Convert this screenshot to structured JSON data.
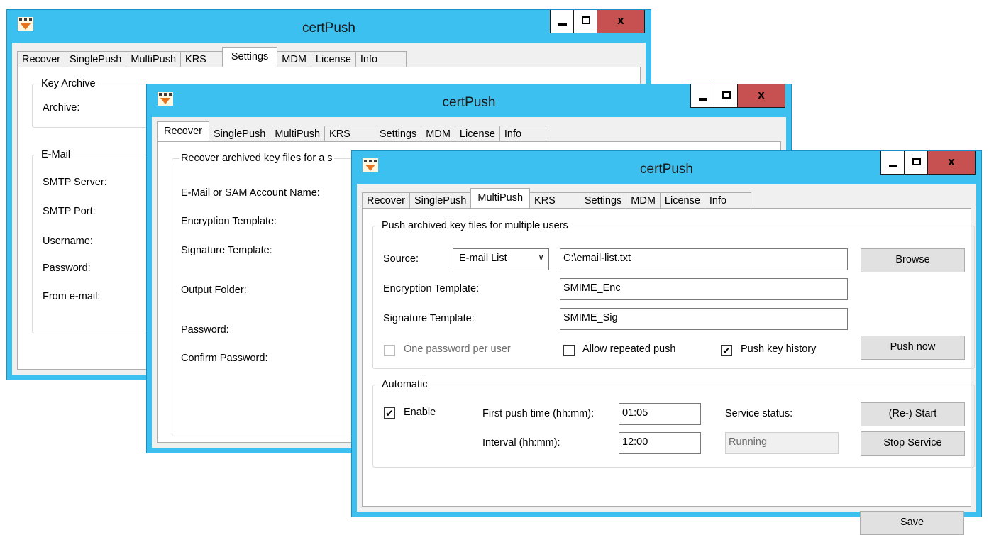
{
  "app_title": "certPush",
  "colors": {
    "titlebar": "#3cc0f0",
    "close_button": "#c75050"
  },
  "tabs": [
    "Recover",
    "SinglePush",
    "MultiPush",
    "KRS",
    "Settings",
    "MDM",
    "License",
    "Info"
  ],
  "window1": {
    "active_tab": "Settings",
    "key_archive": {
      "legend": "Key Archive",
      "archive_label": "Archive:"
    },
    "email": {
      "legend": "E-Mail",
      "smtp_server_label": "SMTP Server:",
      "smtp_port_label": "SMTP Port:",
      "username_label": "Username:",
      "password_label": "Password:",
      "from_label": "From e-mail:"
    }
  },
  "window2": {
    "active_tab": "Recover",
    "group_legend": "Recover archived key files for a s",
    "email_sam_label": "E-Mail or SAM Account Name:",
    "encryption_template_label": "Encryption Template:",
    "signature_template_label": "Signature Template:",
    "output_folder_label": "Output Folder:",
    "password_label": "Password:",
    "confirm_password_label": "Confirm Password:"
  },
  "window3": {
    "active_tab": "MultiPush",
    "push_group": {
      "legend": "Push archived key files for multiple users",
      "source_label": "Source:",
      "source_select": "E-mail List",
      "source_path": "C:\\email-list.txt",
      "browse_button": "Browse",
      "encryption_template_label": "Encryption Template:",
      "encryption_template_value": "SMIME_Enc",
      "signature_template_label": "Signature Template:",
      "signature_template_value": "SMIME_Sig",
      "one_password_label": "One password per user",
      "one_password_checked": false,
      "allow_repeated_label": "Allow repeated push",
      "allow_repeated_checked": false,
      "push_history_label": "Push key history",
      "push_history_checked": true,
      "push_now_button": "Push now"
    },
    "automatic_group": {
      "legend": "Automatic",
      "enable_label": "Enable",
      "enable_checked": true,
      "first_push_label": "First push time (hh:mm):",
      "first_push_value": "01:05",
      "interval_label": "Interval (hh:mm):",
      "interval_value": "12:00",
      "service_status_label": "Service status:",
      "service_status_value": "Running",
      "restart_button": "(Re-) Start",
      "stop_button": "Stop Service"
    },
    "save_button": "Save"
  },
  "checkmark": "✔"
}
